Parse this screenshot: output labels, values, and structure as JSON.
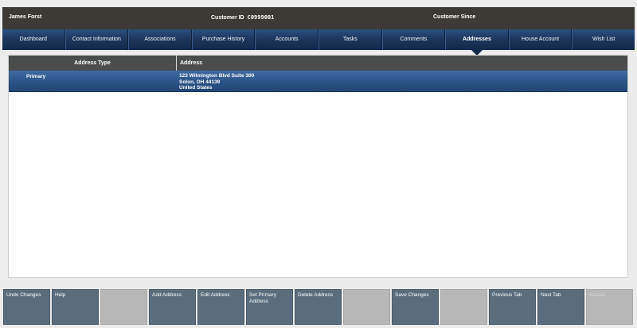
{
  "header": {
    "customer_name": "James Forst",
    "customer_id_label": "Customer ID",
    "customer_id_value": "C0999001",
    "customer_since_label": "Customer Since"
  },
  "tabs": [
    {
      "label": "Dashboard",
      "active": false
    },
    {
      "label": "Contact Information",
      "active": false
    },
    {
      "label": "Associations",
      "active": false
    },
    {
      "label": "Purchase History",
      "active": false
    },
    {
      "label": "Accounts",
      "active": false
    },
    {
      "label": "Tasks",
      "active": false
    },
    {
      "label": "Comments",
      "active": false
    },
    {
      "label": "Addresses",
      "active": true
    },
    {
      "label": "House Account",
      "active": false
    },
    {
      "label": "Wish List",
      "active": false
    }
  ],
  "table": {
    "columns": [
      "Address Type",
      "Address"
    ],
    "rows": [
      {
        "type": "Primary",
        "address_line1": "123 Wilmington Blvd Suite 300",
        "address_line2": "Solon, OH 44139",
        "address_line3": "United States",
        "selected": true
      }
    ]
  },
  "footer": {
    "buttons": [
      {
        "label": "Undo Changes",
        "enabled": true
      },
      {
        "label": "Help",
        "enabled": true
      },
      {
        "label": "",
        "enabled": false
      },
      {
        "label": "Add Address",
        "enabled": true
      },
      {
        "label": "Edit Address",
        "enabled": true
      },
      {
        "label": "Set Primary Address",
        "enabled": true
      },
      {
        "label": "Delete Address",
        "enabled": true
      },
      {
        "label": "",
        "enabled": false
      },
      {
        "label": "Save Changes",
        "enabled": true
      },
      {
        "label": "",
        "enabled": false
      },
      {
        "label": "Previous Tab",
        "enabled": true
      },
      {
        "label": "Next Tab",
        "enabled": true
      },
      {
        "label": "Search",
        "enabled": false
      }
    ]
  }
}
